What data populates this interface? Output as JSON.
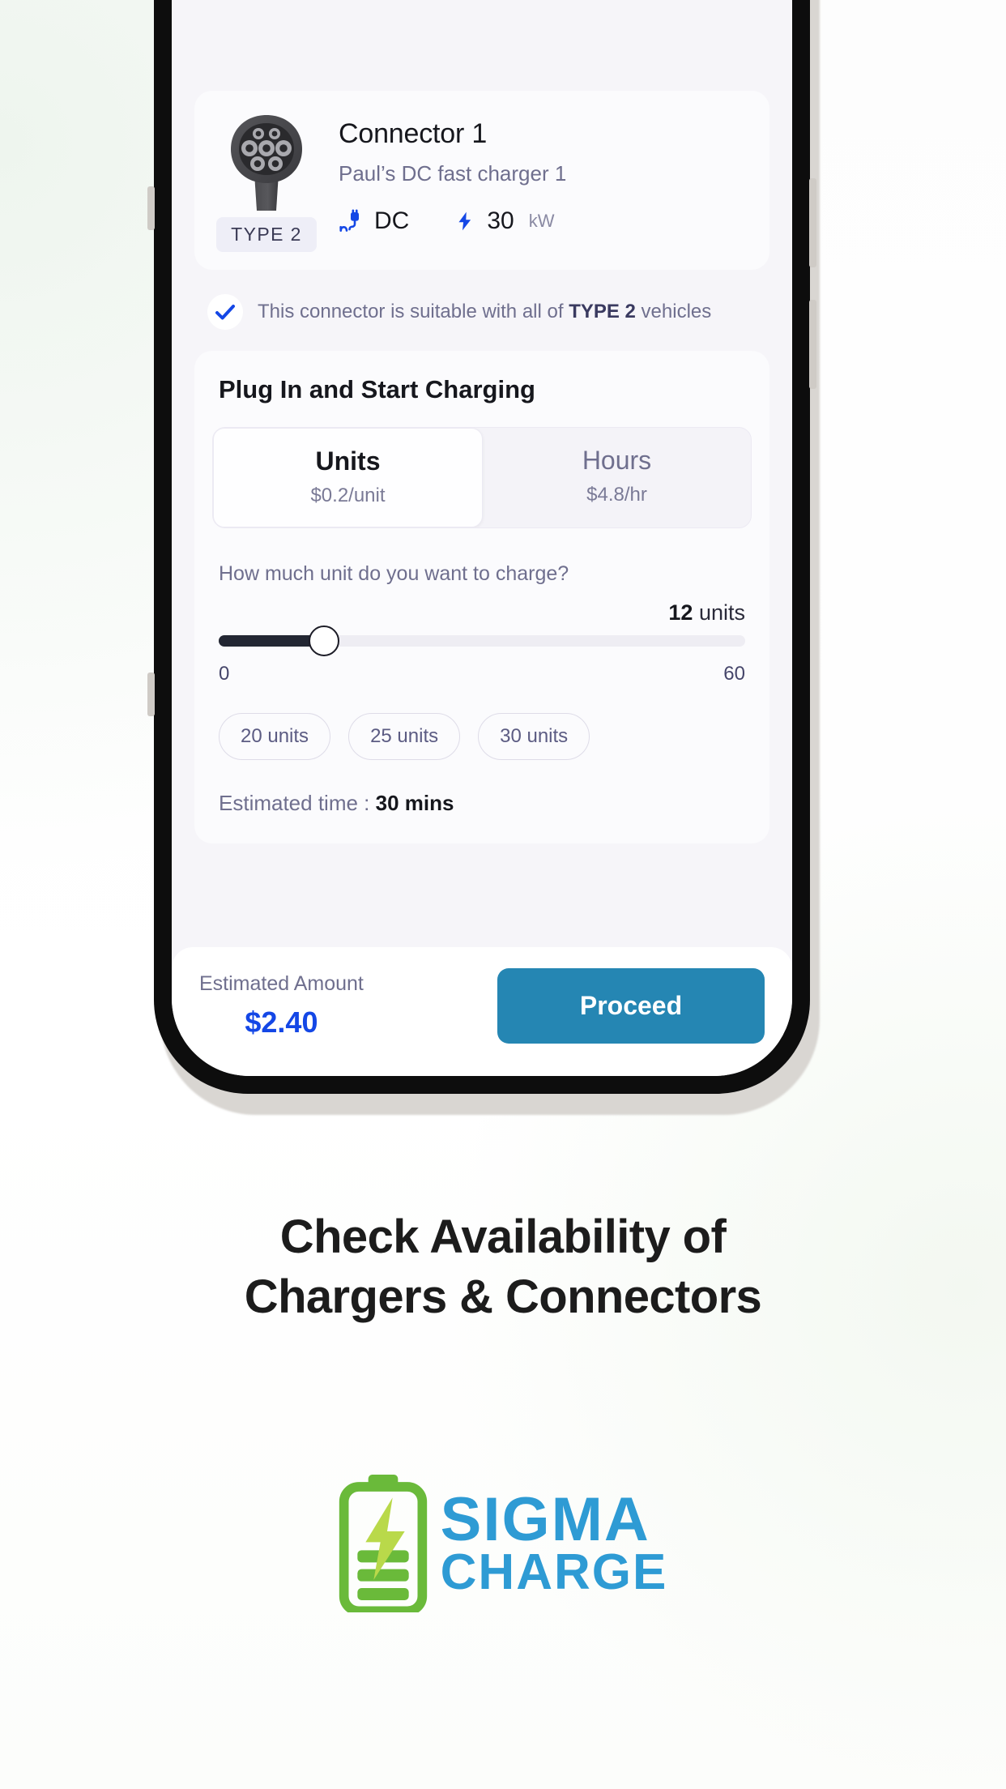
{
  "connector": {
    "title": "Connector 1",
    "subtitle": "Paul’s DC fast charger 1",
    "type_badge": "TYPE  2",
    "current_type": "DC",
    "power_value": "30",
    "power_unit": "kW",
    "plug_icon": "ev-plug-icon",
    "bolt_icon": "lightning-bolt-icon",
    "connector_image": "type2-connector-photo"
  },
  "suitability": {
    "check_icon": "check-icon",
    "prefix": "This connector is suitable with all of ",
    "highlight": "TYPE 2",
    "suffix": " vehicles"
  },
  "plugin": {
    "title": "Plug In and Start Charging",
    "modes": [
      {
        "name": "Units",
        "price": "$0.2/unit",
        "active": true
      },
      {
        "name": "Hours",
        "price": "$4.8/hr",
        "active": false
      }
    ],
    "question": "How much unit do you want to charge?",
    "selected_value": "12",
    "selected_unit": "units",
    "slider": {
      "min_label": "0",
      "max_label": "60",
      "min": 0,
      "max": 60,
      "value": 12,
      "fill_percent": 20
    },
    "quick_chips": [
      "20 units",
      "25 units",
      "30 units"
    ],
    "estimated_time_label": "Estimated time : ",
    "estimated_time_value": "30 mins"
  },
  "bottom_bar": {
    "amount_label": "Estimated Amount",
    "amount_value": "$2.40",
    "proceed_label": "Proceed"
  },
  "headline": {
    "line1": "Check Availability of",
    "line2": "Chargers & Connectors"
  },
  "logo": {
    "battery_icon": "battery-charging-icon",
    "word1": "SIGMA",
    "word2": "CHARGE"
  },
  "colors": {
    "accent_blue": "#1447e6",
    "proceed_blue": "#2586b3",
    "logo_blue": "#2e9bd4",
    "logo_green": "#6aba3a",
    "screen_bg": "#f6f5f9",
    "slider_fill": "#232733"
  }
}
